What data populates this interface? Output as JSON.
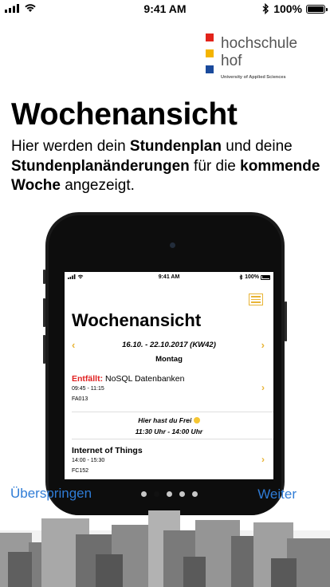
{
  "status_bar": {
    "time": "9:41 AM",
    "battery": "100%"
  },
  "logo": {
    "line1": "hochschule",
    "line2": "hof",
    "sub": "University of Applied Sciences",
    "colors": [
      "#e2231a",
      "#f4b400",
      "#1a4a9c"
    ]
  },
  "title": "Wochenansicht",
  "description": {
    "p1": "Hier werden dein ",
    "b1": "Stundenplan",
    "p2": " und deine ",
    "b2": "Stundenplanänderungen",
    "p3": " für die ",
    "b3": "kommende Woche",
    "p4": " angezeigt."
  },
  "preview": {
    "status_time": "9:41 AM",
    "status_battery": "100%",
    "title": "Wochenansicht",
    "week": "16.10. - 22.10.2017 (KW42)",
    "day": "Montag",
    "entries": [
      {
        "prefix": "Entfällt:",
        "name": " NoSQL Datenbanken",
        "time": "09:45 - 11:15",
        "room": "FA013"
      },
      {
        "free_text": "Hier hast du Frei",
        "free_time": "11:30 Uhr - 14:00 Uhr"
      },
      {
        "name": "Internet of Things",
        "time": "14:00 - 15:30",
        "room": "FC152"
      }
    ]
  },
  "controls": {
    "skip": "Überspringen",
    "next": "Weiter",
    "page_count": 5,
    "active_page": 2
  },
  "colors": {
    "accent": "#2f7cd6",
    "highlight": "#e8b436",
    "cancel": "#e02020"
  }
}
